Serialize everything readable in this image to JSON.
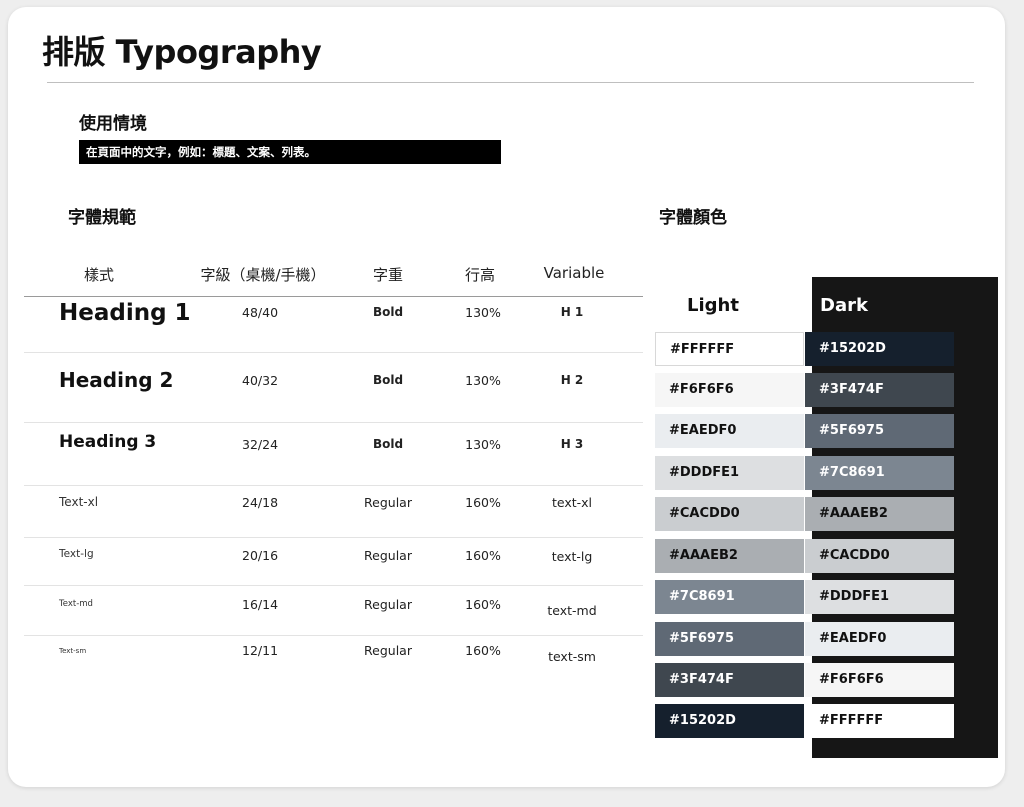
{
  "title": "排版 Typography",
  "usage": {
    "heading": "使用情境",
    "description": "在頁面中的文字，例如：標題、文案、列表。"
  },
  "spec": {
    "heading": "字體規範",
    "columns": {
      "style": "樣式",
      "size": "字級（桌機/手機）",
      "weight": "字重",
      "line_height": "行高",
      "variable": "Variable"
    },
    "rows": [
      {
        "style": "Heading 1",
        "size": "48/40",
        "weight": "Bold",
        "line_height": "130%",
        "variable": "H 1"
      },
      {
        "style": "Heading 2",
        "size": "40/32",
        "weight": "Bold",
        "line_height": "130%",
        "variable": "H 2"
      },
      {
        "style": "Heading 3",
        "size": "32/24",
        "weight": "Bold",
        "line_height": "130%",
        "variable": "H 3"
      },
      {
        "style": "Text-xl",
        "size": "24/18",
        "weight": "Regular",
        "line_height": "160%",
        "variable": "text-xl"
      },
      {
        "style": "Text-lg",
        "size": "20/16",
        "weight": "Regular",
        "line_height": "160%",
        "variable": "text-lg"
      },
      {
        "style": "Text-md",
        "size": "16/14",
        "weight": "Regular",
        "line_height": "160%",
        "variable": "text-md"
      },
      {
        "style": "Text-sm",
        "size": "12/11",
        "weight": "Regular",
        "line_height": "160%",
        "variable": "text-sm"
      }
    ]
  },
  "colors": {
    "heading": "字體顏色",
    "light_label": "Light",
    "dark_label": "Dark",
    "light_swatches": [
      {
        "label": "#FFFFFF",
        "bg": "#FFFFFF",
        "fg": "#111111"
      },
      {
        "label": "#F6F6F6",
        "bg": "#F6F6F6",
        "fg": "#111111"
      },
      {
        "label": "#EAEDF0",
        "bg": "#EAEDF0",
        "fg": "#111111"
      },
      {
        "label": "#DDDFE1",
        "bg": "#DDDFE1",
        "fg": "#111111"
      },
      {
        "label": "#CACDD0",
        "bg": "#CACDD0",
        "fg": "#111111"
      },
      {
        "label": "#AAAEB2",
        "bg": "#AAAEB2",
        "fg": "#111111"
      },
      {
        "label": "#7C8691",
        "bg": "#7C8691",
        "fg": "#FFFFFF"
      },
      {
        "label": "#5F6975",
        "bg": "#5F6975",
        "fg": "#FFFFFF"
      },
      {
        "label": "#3F474F",
        "bg": "#3F474F",
        "fg": "#FFFFFF"
      },
      {
        "label": "#15202D",
        "bg": "#15202D",
        "fg": "#FFFFFF"
      }
    ],
    "dark_swatches": [
      {
        "label": "#15202D",
        "bg": "#15202D",
        "fg": "#FFFFFF"
      },
      {
        "label": "#3F474F",
        "bg": "#3F474F",
        "fg": "#FFFFFF"
      },
      {
        "label": "#5F6975",
        "bg": "#5F6975",
        "fg": "#FFFFFF"
      },
      {
        "label": "#7C8691",
        "bg": "#7C8691",
        "fg": "#FFFFFF"
      },
      {
        "label": "#AAAEB2",
        "bg": "#AAAEB2",
        "fg": "#111111"
      },
      {
        "label": "#CACDD0",
        "bg": "#CACDD0",
        "fg": "#111111"
      },
      {
        "label": "#DDDFE1",
        "bg": "#DDDFE1",
        "fg": "#111111"
      },
      {
        "label": "#EAEDF0",
        "bg": "#EAEDF0",
        "fg": "#111111"
      },
      {
        "label": "#F6F6F6",
        "bg": "#F6F6F6",
        "fg": "#111111"
      },
      {
        "label": "#FFFFFF",
        "bg": "#FFFFFF",
        "fg": "#111111"
      }
    ]
  }
}
